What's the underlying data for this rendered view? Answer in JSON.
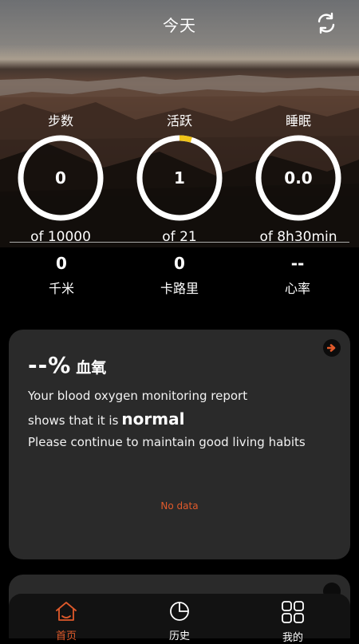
{
  "header": {
    "title": "今天"
  },
  "stats": [
    {
      "label": "步数",
      "value": "0",
      "goal": "of 10000",
      "progress": 0
    },
    {
      "label": "活跃",
      "value": "1",
      "goal": "of 21",
      "progress": 0.048
    },
    {
      "label": "睡眠",
      "value": "0.0",
      "goal": "of 8h30min",
      "progress": 0
    }
  ],
  "metrics": [
    {
      "value": "0",
      "label": "千米"
    },
    {
      "value": "0",
      "label": "卡路里"
    },
    {
      "value": "--",
      "label": "心率"
    }
  ],
  "oxygen_card": {
    "value": "--%",
    "title": "血氧",
    "line1": "Your blood oxygen monitoring report",
    "line2_prefix": "shows that it is",
    "line2_status": "normal",
    "line3": "Please continue to maintain good living habits",
    "no_data": "No data"
  },
  "tabs": [
    {
      "label": "首页",
      "icon": "home-icon",
      "active": true
    },
    {
      "label": "历史",
      "icon": "pie-chart-icon",
      "active": false
    },
    {
      "label": "我的",
      "icon": "grid-icon",
      "active": false
    }
  ],
  "colors": {
    "accent": "#e05a2b",
    "ring": "#ffffff",
    "ring_progress": "#f0c419",
    "card": "#2a2a2a"
  }
}
